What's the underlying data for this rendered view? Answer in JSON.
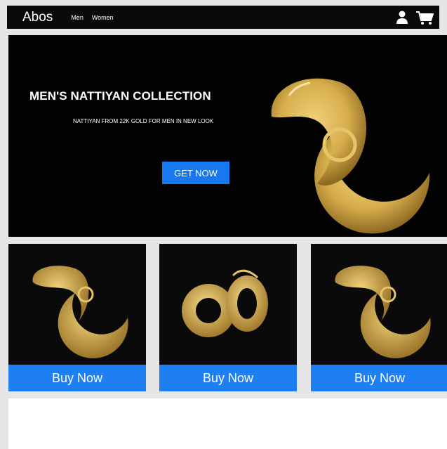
{
  "nav": {
    "brand": "Abos",
    "links": [
      "Men",
      "Women"
    ],
    "icons": [
      "user-icon",
      "cart-icon"
    ]
  },
  "hero": {
    "title": "MEN'S NATTIYAN COLLECTION",
    "subtitle": "NATTIYAN FROM 22K GOLD FOR MEN IN NEW LOOK",
    "cta": "GET NOW"
  },
  "products": [
    {
      "button": "Buy Now"
    },
    {
      "button": "Buy Now"
    },
    {
      "button": "Buy Now"
    }
  ],
  "colors": {
    "navbar": "#0a0a0a",
    "accent": "#1d7ff2",
    "gold": "#d8b251",
    "hero_bg": "#020202"
  }
}
